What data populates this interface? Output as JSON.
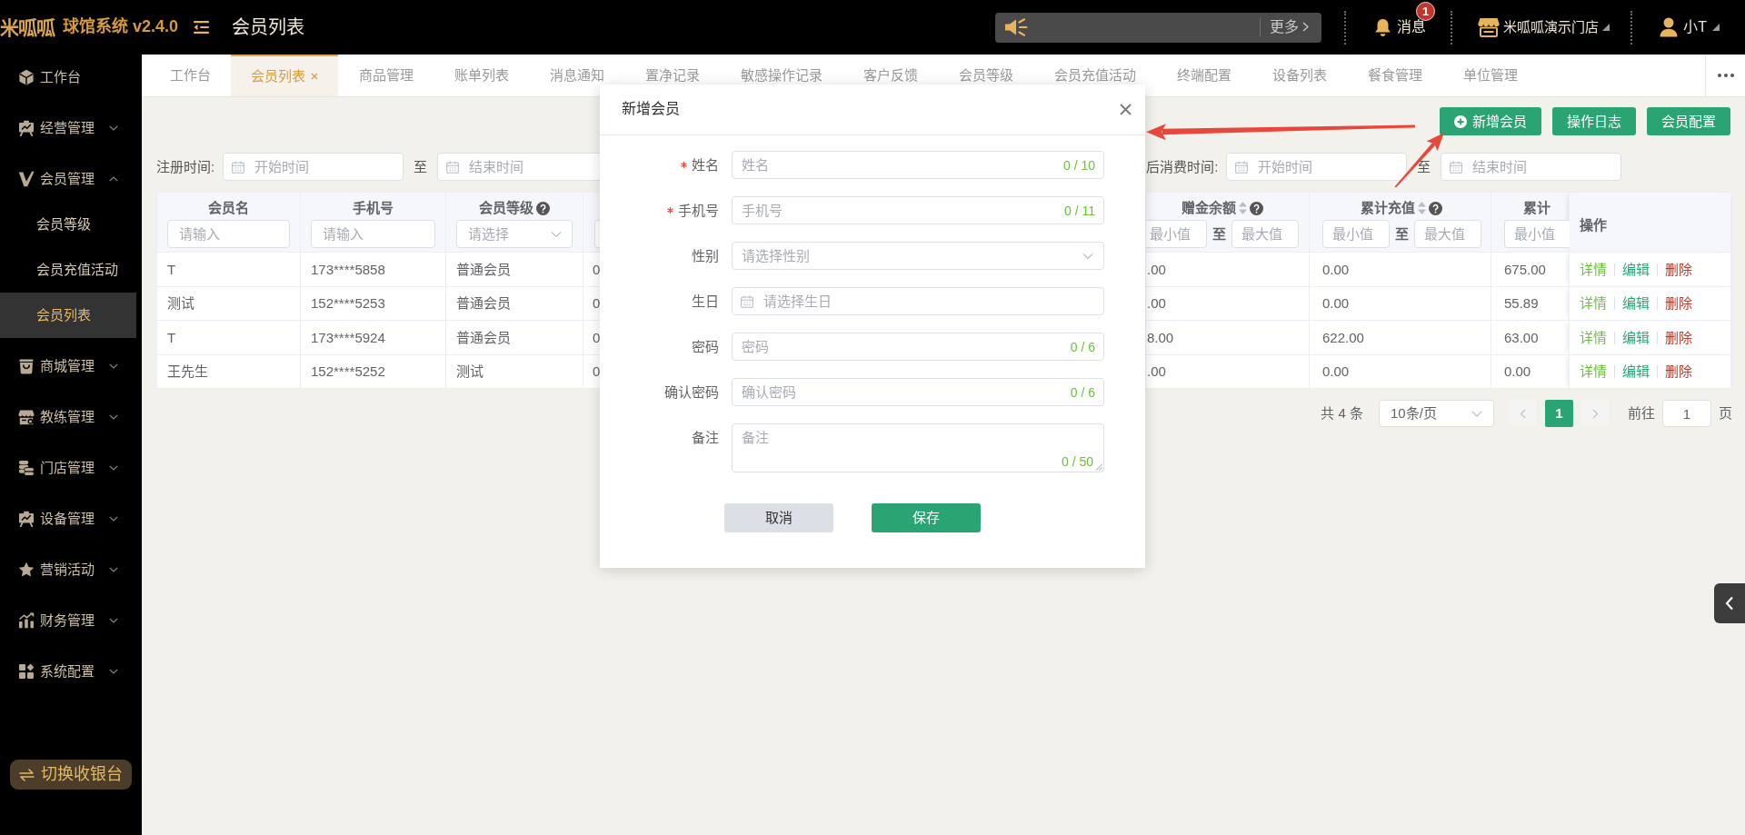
{
  "topbar": {
    "logo": "米呱呱",
    "app_title": "球馆系统 v2.4.0",
    "page_title": "会员列表",
    "notice": {
      "more": "更多"
    },
    "messages": {
      "label": "消息",
      "badge": "1"
    },
    "store": {
      "label": "米呱呱演示门店"
    },
    "user": {
      "label": "小T"
    }
  },
  "sidebar": {
    "items": [
      {
        "label": "工作台",
        "kind": "link",
        "selected": false
      },
      {
        "label": "经营管理",
        "kind": "group",
        "expanded": false
      },
      {
        "label": "会员管理",
        "kind": "group",
        "expanded": true,
        "children": [
          {
            "label": "会员等级",
            "selected": false
          },
          {
            "label": "会员充值活动",
            "selected": false
          },
          {
            "label": "会员列表",
            "selected": true
          }
        ]
      },
      {
        "label": "商城管理",
        "kind": "group",
        "expanded": false
      },
      {
        "label": "教练管理",
        "kind": "group",
        "expanded": false
      },
      {
        "label": "门店管理",
        "kind": "group",
        "expanded": false
      },
      {
        "label": "设备管理",
        "kind": "group",
        "expanded": false
      },
      {
        "label": "营销活动",
        "kind": "group",
        "expanded": false
      },
      {
        "label": "财务管理",
        "kind": "group",
        "expanded": false
      },
      {
        "label": "系统配置",
        "kind": "group",
        "expanded": false
      }
    ],
    "switch_button": "切换收银台"
  },
  "tabs": [
    {
      "label": "工作台",
      "selected": false
    },
    {
      "label": "会员列表",
      "selected": true
    },
    {
      "label": "商品管理",
      "selected": false
    },
    {
      "label": "账单列表",
      "selected": false
    },
    {
      "label": "消息通知",
      "selected": false
    },
    {
      "label": "置净记录",
      "selected": false
    },
    {
      "label": "敏感操作记录",
      "selected": false
    },
    {
      "label": "客户反馈",
      "selected": false
    },
    {
      "label": "会员等级",
      "selected": false
    },
    {
      "label": "会员充值活动",
      "selected": false
    },
    {
      "label": "终端配置",
      "selected": false
    },
    {
      "label": "设备列表",
      "selected": false
    },
    {
      "label": "餐食管理",
      "selected": false
    },
    {
      "label": "单位管理",
      "selected": false
    }
  ],
  "toolbar": [
    {
      "label": "新增会员",
      "kind": "add"
    },
    {
      "label": "操作日志",
      "kind": "plain"
    },
    {
      "label": "会员配置",
      "kind": "plain"
    }
  ],
  "filters": [
    {
      "label": "注册时间:",
      "start_placeholder": "开始时间",
      "separator": "至",
      "end_placeholder": "结束时间"
    },
    {
      "label": "后消费时间:",
      "start_placeholder": "开始时间",
      "separator": "至",
      "end_placeholder": "结束时间"
    }
  ],
  "table": {
    "columns": [
      {
        "title": "会员名",
        "kind": "text",
        "help": false,
        "sortable": false,
        "placeholder": "请输入"
      },
      {
        "title": "手机号",
        "kind": "text",
        "help": false,
        "sortable": false,
        "placeholder": "请输入"
      },
      {
        "title": "会员等级",
        "kind": "select",
        "help": true,
        "sortable": false,
        "placeholder": "请选择"
      },
      {
        "kind": "covered"
      },
      {
        "title": "赠金余额",
        "kind": "range",
        "help": true,
        "sortable": true,
        "min_placeholder": "最小值",
        "separator": "至",
        "max_placeholder": "最大值"
      },
      {
        "title": "累计充值",
        "kind": "range",
        "help": true,
        "sortable": true,
        "min_placeholder": "最小值",
        "separator": "至",
        "max_placeholder": "最大值"
      },
      {
        "title": "累计",
        "kind": "range",
        "min_placeholder": "最小值"
      },
      {
        "title": "操作",
        "kind": "actions",
        "help": false,
        "sortable": false
      }
    ],
    "rows": [
      {
        "cells": [
          "T",
          "173****5858",
          "普通会员",
          "0",
          ".00",
          "0.00",
          "675.00"
        ],
        "actions": [
          {
            "label": "详情",
            "kind": "view"
          },
          {
            "label": "编辑",
            "kind": "edit"
          },
          {
            "label": "删除",
            "kind": "delete"
          }
        ]
      },
      {
        "cells": [
          "测试",
          "152****5253",
          "普通会员",
          "0",
          ".00",
          "0.00",
          "55.89"
        ],
        "actions": [
          {
            "label": "详情",
            "kind": "view"
          },
          {
            "label": "编辑",
            "kind": "edit"
          },
          {
            "label": "删除",
            "kind": "delete"
          }
        ]
      },
      {
        "cells": [
          "T",
          "173****5924",
          "普通会员",
          "0",
          "8.00",
          "622.00",
          "63.00"
        ],
        "actions": [
          {
            "label": "详情",
            "kind": "view"
          },
          {
            "label": "编辑",
            "kind": "edit"
          },
          {
            "label": "删除",
            "kind": "delete"
          }
        ]
      },
      {
        "cells": [
          "王先生",
          "152****5252",
          "测试",
          "0",
          ".00",
          "0.00",
          "0.00"
        ],
        "actions": [
          {
            "label": "详情",
            "kind": "view"
          },
          {
            "label": "编辑",
            "kind": "edit"
          },
          {
            "label": "删除",
            "kind": "delete"
          }
        ]
      }
    ]
  },
  "pagination": {
    "total": "共 4 条",
    "page_size": "10条/页",
    "prev_disabled": true,
    "pages": [
      {
        "label": "1",
        "selected": true
      }
    ],
    "next_disabled": true,
    "goto_label": "前往",
    "goto_value": "1",
    "goto_suffix": "页"
  },
  "modal": {
    "title": "新增会员",
    "fields": [
      {
        "label": "姓名",
        "required": true,
        "kind": "text",
        "placeholder": "姓名",
        "counter": "0 / 10"
      },
      {
        "label": "手机号",
        "required": true,
        "kind": "text",
        "placeholder": "手机号",
        "counter": "0 / 11"
      },
      {
        "label": "性别",
        "required": false,
        "kind": "select",
        "placeholder": "请选择性别"
      },
      {
        "label": "生日",
        "required": false,
        "kind": "date",
        "placeholder": "请选择生日"
      },
      {
        "label": "密码",
        "required": false,
        "kind": "text",
        "placeholder": "密码",
        "counter": "0 / 6"
      },
      {
        "label": "确认密码",
        "required": false,
        "kind": "text",
        "placeholder": "确认密码",
        "counter": "0 / 6"
      },
      {
        "label": "备注",
        "required": false,
        "kind": "textarea",
        "placeholder": "备注",
        "counter": "0 / 50"
      }
    ],
    "buttons": [
      {
        "label": "取消",
        "kind": "secondary"
      },
      {
        "label": "保存",
        "kind": "primary"
      }
    ]
  }
}
